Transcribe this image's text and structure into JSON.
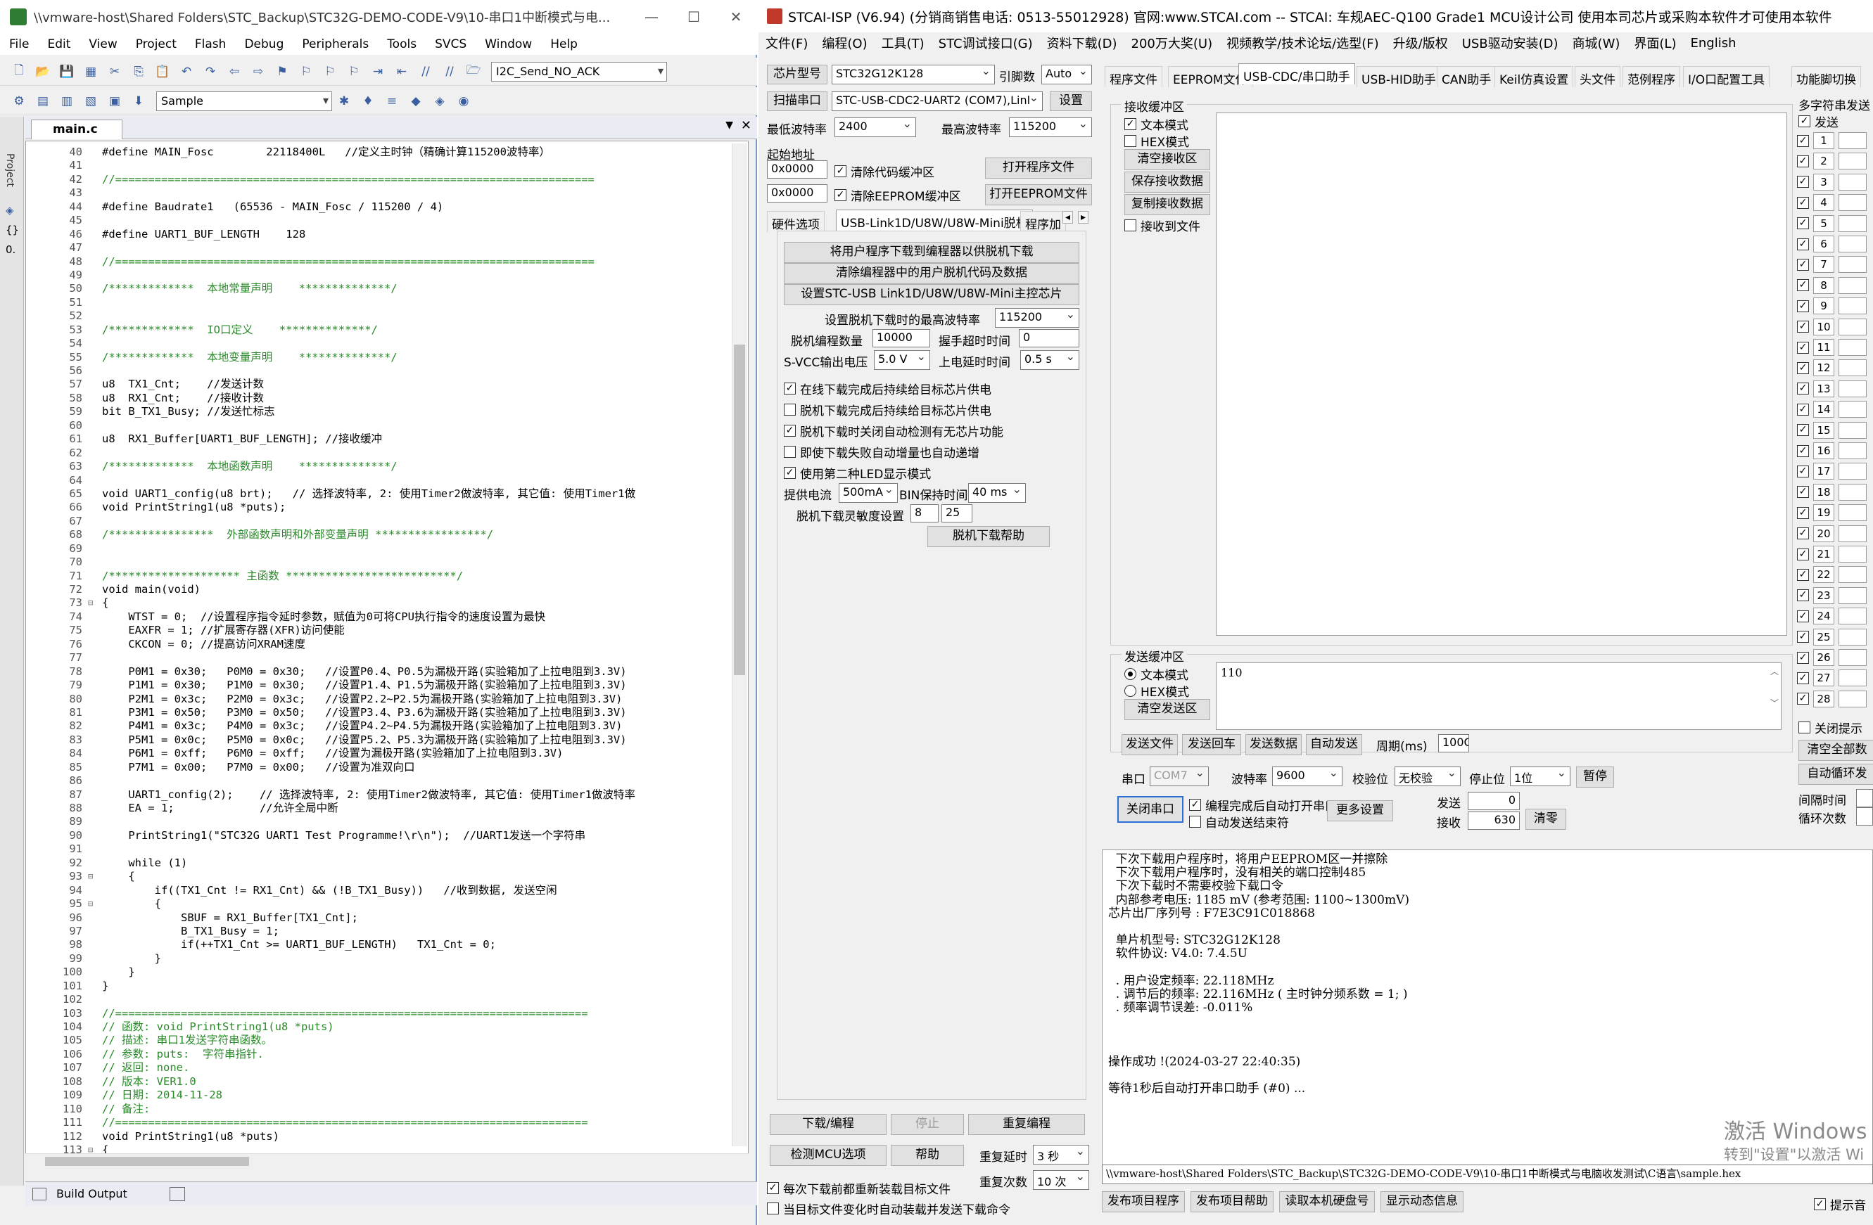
{
  "keil": {
    "title": "\\\\vmware-host\\Shared Folders\\STC_Backup\\STC32G-DEMO-CODE-V9\\10-串口1中断模式与电...",
    "menu": [
      "File",
      "Edit",
      "View",
      "Project",
      "Flash",
      "Debug",
      "Peripherals",
      "Tools",
      "SVCS",
      "Window",
      "Help"
    ],
    "toolbar_func": "I2C_Send_NO_ACK",
    "target": "Sample",
    "side_label": "Project",
    "file_tab": "main.c",
    "bottom_tab": "Build Output",
    "lines": [
      {
        "n": "40",
        "f": "",
        "c": "n",
        "t": "#define MAIN_Fosc        22118400L   //定义主时钟（精确计算115200波特率）"
      },
      {
        "n": "41",
        "f": "",
        "c": "n",
        "t": ""
      },
      {
        "n": "42",
        "f": "",
        "c": "cm",
        "t": "//========================================================================="
      },
      {
        "n": "43",
        "f": "",
        "c": "n",
        "t": ""
      },
      {
        "n": "44",
        "f": "",
        "c": "n",
        "t": "#define Baudrate1   (65536 - MAIN_Fosc / 115200 / 4)"
      },
      {
        "n": "45",
        "f": "",
        "c": "n",
        "t": ""
      },
      {
        "n": "46",
        "f": "",
        "c": "n",
        "t": "#define UART1_BUF_LENGTH    128"
      },
      {
        "n": "47",
        "f": "",
        "c": "n",
        "t": ""
      },
      {
        "n": "48",
        "f": "",
        "c": "cm",
        "t": "//========================================================================="
      },
      {
        "n": "49",
        "f": "",
        "c": "n",
        "t": ""
      },
      {
        "n": "50",
        "f": "",
        "c": "cm",
        "t": "/*************  本地常量声明    **************/"
      },
      {
        "n": "51",
        "f": "",
        "c": "n",
        "t": ""
      },
      {
        "n": "52",
        "f": "",
        "c": "n",
        "t": ""
      },
      {
        "n": "53",
        "f": "",
        "c": "cm",
        "t": "/*************  IO口定义    **************/"
      },
      {
        "n": "54",
        "f": "",
        "c": "n",
        "t": ""
      },
      {
        "n": "55",
        "f": "",
        "c": "cm",
        "t": "/*************  本地变量声明    **************/"
      },
      {
        "n": "56",
        "f": "",
        "c": "n",
        "t": ""
      },
      {
        "n": "57",
        "f": "",
        "c": "n",
        "t": "u8  TX1_Cnt;    //发送计数"
      },
      {
        "n": "58",
        "f": "",
        "c": "n",
        "t": "u8  RX1_Cnt;    //接收计数"
      },
      {
        "n": "59",
        "f": "",
        "c": "n",
        "t": "bit B_TX1_Busy; //发送忙标志"
      },
      {
        "n": "60",
        "f": "",
        "c": "n",
        "t": ""
      },
      {
        "n": "61",
        "f": "",
        "c": "n",
        "t": "u8  RX1_Buffer[UART1_BUF_LENGTH]; //接收缓冲"
      },
      {
        "n": "62",
        "f": "",
        "c": "n",
        "t": ""
      },
      {
        "n": "63",
        "f": "",
        "c": "cm",
        "t": "/*************  本地函数声明    **************/"
      },
      {
        "n": "64",
        "f": "",
        "c": "n",
        "t": ""
      },
      {
        "n": "65",
        "f": "",
        "c": "n",
        "t": "void UART1_config(u8 brt);   // 选择波特率, 2: 使用Timer2做波特率, 其它值: 使用Timer1做"
      },
      {
        "n": "66",
        "f": "",
        "c": "n",
        "t": "void PrintString1(u8 *puts);"
      },
      {
        "n": "67",
        "f": "",
        "c": "n",
        "t": ""
      },
      {
        "n": "68",
        "f": "",
        "c": "cm",
        "t": "/****************  外部函数声明和外部变量声明 *****************/"
      },
      {
        "n": "69",
        "f": "",
        "c": "n",
        "t": ""
      },
      {
        "n": "70",
        "f": "",
        "c": "n",
        "t": ""
      },
      {
        "n": "71",
        "f": "",
        "c": "cm",
        "t": "/******************** 主函数 **************************/"
      },
      {
        "n": "72",
        "f": "",
        "c": "n",
        "t": "void main(void)"
      },
      {
        "n": "73",
        "f": "⊟",
        "c": "n",
        "t": "{"
      },
      {
        "n": "74",
        "f": "",
        "c": "n",
        "t": "    WTST = 0;  //设置程序指令延时参数，赋值为0可将CPU执行指令的速度设置为最快"
      },
      {
        "n": "75",
        "f": "",
        "c": "n",
        "t": "    EAXFR = 1; //扩展寄存器(XFR)访问使能"
      },
      {
        "n": "76",
        "f": "",
        "c": "n",
        "t": "    CKCON = 0; //提高访问XRAM速度"
      },
      {
        "n": "77",
        "f": "",
        "c": "n",
        "t": ""
      },
      {
        "n": "78",
        "f": "",
        "c": "n",
        "t": "    P0M1 = 0x30;   P0M0 = 0x30;   //设置P0.4、P0.5为漏极开路(实验箱加了上拉电阻到3.3V)"
      },
      {
        "n": "79",
        "f": "",
        "c": "n",
        "t": "    P1M1 = 0x30;   P1M0 = 0x30;   //设置P1.4、P1.5为漏极开路(实验箱加了上拉电阻到3.3V)"
      },
      {
        "n": "80",
        "f": "",
        "c": "n",
        "t": "    P2M1 = 0x3c;   P2M0 = 0x3c;   //设置P2.2~P2.5为漏极开路(实验箱加了上拉电阻到3.3V)"
      },
      {
        "n": "81",
        "f": "",
        "c": "n",
        "t": "    P3M1 = 0x50;   P3M0 = 0x50;   //设置P3.4、P3.6为漏极开路(实验箱加了上拉电阻到3.3V)"
      },
      {
        "n": "82",
        "f": "",
        "c": "n",
        "t": "    P4M1 = 0x3c;   P4M0 = 0x3c;   //设置P4.2~P4.5为漏极开路(实验箱加了上拉电阻到3.3V)"
      },
      {
        "n": "83",
        "f": "",
        "c": "n",
        "t": "    P5M1 = 0x0c;   P5M0 = 0x0c;   //设置P5.2、P5.3为漏极开路(实验箱加了上拉电阻到3.3V)"
      },
      {
        "n": "84",
        "f": "",
        "c": "n",
        "t": "    P6M1 = 0xff;   P6M0 = 0xff;   //设置为漏极开路(实验箱加了上拉电阻到3.3V)"
      },
      {
        "n": "85",
        "f": "",
        "c": "n",
        "t": "    P7M1 = 0x00;   P7M0 = 0x00;   //设置为准双向口"
      },
      {
        "n": "86",
        "f": "",
        "c": "n",
        "t": ""
      },
      {
        "n": "87",
        "f": "",
        "c": "n",
        "t": "    UART1_config(2);    // 选择波特率, 2: 使用Timer2做波特率, 其它值: 使用Timer1做波特率"
      },
      {
        "n": "88",
        "f": "",
        "c": "n",
        "t": "    EA = 1;             //允许全局中断"
      },
      {
        "n": "89",
        "f": "",
        "c": "n",
        "t": ""
      },
      {
        "n": "90",
        "f": "",
        "c": "n",
        "t": "    PrintString1(\"STC32G UART1 Test Programme!\\r\\n\");  //UART1发送一个字符串"
      },
      {
        "n": "91",
        "f": "",
        "c": "n",
        "t": ""
      },
      {
        "n": "92",
        "f": "",
        "c": "n",
        "t": "    while (1)"
      },
      {
        "n": "93",
        "f": "⊟",
        "c": "n",
        "t": "    {"
      },
      {
        "n": "94",
        "f": "",
        "c": "n",
        "t": "        if((TX1_Cnt != RX1_Cnt) && (!B_TX1_Busy))   //收到数据, 发送空闲"
      },
      {
        "n": "95",
        "f": "⊟",
        "c": "n",
        "t": "        {"
      },
      {
        "n": "96",
        "f": "",
        "c": "n",
        "t": "            SBUF = RX1_Buffer[TX1_Cnt];"
      },
      {
        "n": "97",
        "f": "",
        "c": "n",
        "t": "            B_TX1_Busy = 1;"
      },
      {
        "n": "98",
        "f": "",
        "c": "n",
        "t": "            if(++TX1_Cnt >= UART1_BUF_LENGTH)   TX1_Cnt = 0;"
      },
      {
        "n": "99",
        "f": "",
        "c": "n",
        "t": "        }"
      },
      {
        "n": "100",
        "f": "",
        "c": "n",
        "t": "    }"
      },
      {
        "n": "101",
        "f": "",
        "c": "n",
        "t": "}"
      },
      {
        "n": "102",
        "f": "",
        "c": "n",
        "t": ""
      },
      {
        "n": "103",
        "f": "",
        "c": "cm",
        "t": "//========================================================================"
      },
      {
        "n": "104",
        "f": "",
        "c": "cm",
        "t": "// 函数: void PrintString1(u8 *puts)"
      },
      {
        "n": "105",
        "f": "",
        "c": "cm",
        "t": "// 描述: 串口1发送字符串函数。"
      },
      {
        "n": "106",
        "f": "",
        "c": "cm",
        "t": "// 参数: puts:  字符串指针."
      },
      {
        "n": "107",
        "f": "",
        "c": "cm",
        "t": "// 返回: none."
      },
      {
        "n": "108",
        "f": "",
        "c": "cm",
        "t": "// 版本: VER1.0"
      },
      {
        "n": "109",
        "f": "",
        "c": "cm",
        "t": "// 日期: 2014-11-28"
      },
      {
        "n": "110",
        "f": "",
        "c": "cm",
        "t": "// 备注:"
      },
      {
        "n": "111",
        "f": "",
        "c": "cm",
        "t": "//========================================================================"
      },
      {
        "n": "112",
        "f": "",
        "c": "n",
        "t": "void PrintString1(u8 *puts)"
      },
      {
        "n": "113",
        "f": "⊟",
        "c": "n",
        "t": "{"
      }
    ]
  },
  "stc": {
    "title": "STCAI-ISP (V6.94) (分销商销售电话: 0513-55012928) 官网:www.STCAI.com  -- STCAI: 车规AEC-Q100 Grade1 MCU设计公司 使用本司芯片或采购本软件才可使用本软件",
    "menu": [
      "文件(F)",
      "编程(O)",
      "工具(T)",
      "STC调试接口(G)",
      "资料下载(D)",
      "200万大奖(U)",
      "视频教学/技术论坛/选型(F)",
      "升级/版权",
      "USB驱动安装(D)",
      "商城(W)",
      "界面(L)",
      "English"
    ],
    "chip_label": "芯片型号",
    "chip": "STC32G12K128",
    "pins_label": "引脚数",
    "pins": "Auto",
    "scan_btn": "扫描串口",
    "port": "STC-USB-CDC2-UART2 (COM7),Linl",
    "settings_btn": "设置",
    "min_baud_label": "最低波特率",
    "min_baud": "2400",
    "max_baud_label": "最高波特率",
    "max_baud": "115200",
    "start_addr_label": "起始地址",
    "addr1": "0x0000",
    "addr2": "0x0000",
    "clear_code_buf": "清除代码缓冲区",
    "clear_eeprom_buf": "清除EEPROM缓冲区",
    "open_prog_btn": "打开程序文件",
    "open_eeprom_btn": "打开EEPROM文件",
    "left_tabs": [
      "硬件选项",
      "USB-Link1D/U8W/U8W-Mini脱机",
      "程序加"
    ],
    "offline_btns": [
      "将用户程序下载到编程器以供脱机下载",
      "清除编程器中的用户脱机代码及数据",
      "设置STC-USB Link1D/U8W/U8W-Mini主控芯片"
    ],
    "offline_max_baud_label": "设置脱机下载时的最高波特率",
    "offline_max_baud": "115200",
    "offline_count_label": "脱机编程数量",
    "offline_count": "10000",
    "handshake_label": "握手超时时间",
    "handshake": "0",
    "svcc_label": "S-VCC输出电压",
    "svcc": "5.0 V",
    "power_delay_label": "上电延时时间",
    "power_delay": "0.5 s",
    "offline_opts": [
      {
        "label": "在线下载完成后持续给目标芯片供电",
        "checked": "✓"
      },
      {
        "label": "脱机下载完成后持续给目标芯片供电",
        "checked": ""
      },
      {
        "label": "脱机下载时关闭自动检测有无芯片功能",
        "checked": "✓"
      },
      {
        "label": "即使下载失败自动增量也自动递增",
        "checked": ""
      },
      {
        "label": "使用第二种LED显示模式",
        "checked": "✓"
      }
    ],
    "supply_current_label": "提供电流",
    "supply_current": "500mA",
    "bin_hold_label": "BIN保持时间",
    "bin_hold": "40 ms",
    "sensitivity_label": "脱机下载灵敏度设置",
    "sens1": "8",
    "sens2": "25",
    "offline_help_btn": "脱机下载帮助",
    "download_btn": "下载/编程",
    "stop_btn": "停止",
    "reprogram_btn": "重复编程",
    "check_mcu_btn": "检测MCU选项",
    "help_btn": "帮助",
    "repeat_delay_label": "重复延时",
    "repeat_delay": "3 秒",
    "repeat_count_label": "重复次数",
    "repeat_count": "10 次",
    "reload_before": "每次下载前都重新装载目标文件",
    "auto_reload": "当目标文件变化时自动装载并发送下载命令",
    "right_tabs": [
      "程序文件",
      "EEPROM文件",
      "USB-CDC/串口助手",
      "USB-HID助手",
      "CAN助手",
      "Keil仿真设置",
      "头文件",
      "范例程序",
      "I/O口配置工具",
      "功能脚切换"
    ],
    "recv_group": "接收缓冲区",
    "recv_text_mode": "文本模式",
    "recv_hex_mode": "HEX模式",
    "clear_recv_btn": "清空接收区",
    "save_recv_btn": "保存接收数据",
    "copy_recv_btn": "复制接收数据",
    "recv_to_file": "接收到文件",
    "send_group": "发送缓冲区",
    "send_text_mode": "文本模式",
    "send_hex_mode": "HEX模式",
    "clear_send_btn": "清空发送区",
    "send_content": "110",
    "send_file_btn": "发送文件",
    "send_return_btn": "发送回车",
    "send_data_btn": "发送数据",
    "auto_send_btn": "自动发送",
    "period_label": "周期(ms)",
    "period": "100C",
    "serial_label": "串口",
    "serial": "COM7",
    "baud_label": "波特率",
    "baud": "9600",
    "parity_label": "校验位",
    "parity": "无校验",
    "stop_label": "停止位",
    "stop": "1位",
    "pause_btn": "暂停",
    "close_port_btn": "关闭串口",
    "auto_open_after": "编程完成后自动打开串口",
    "auto_send_end": "自动发送结束符",
    "more_settings_btn": "更多设置",
    "send_count_label": "发送",
    "send_count": "0",
    "recv_count_label": "接收",
    "recv_count": "630",
    "clear_count_btn": "清零",
    "multi_label": "多字符串发送",
    "multi_send": "发送",
    "multi_rows": [
      "1",
      "2",
      "3",
      "4",
      "5",
      "6",
      "7",
      "8",
      "9",
      "10",
      "11",
      "12",
      "13",
      "14",
      "15",
      "16",
      "17",
      "18",
      "19",
      "20",
      "21",
      "22",
      "23",
      "24",
      "25",
      "26",
      "27",
      "28"
    ],
    "close_tip": "关闭提示",
    "clear_all_btn": "清空全部数",
    "auto_loop_btn": "自动循环发",
    "interval_label": "间隔时间",
    "loop_label": "循环次数",
    "log": [
      "  下次下载用户程序时，将用户EEPROM区一并擦除",
      "  下次下载用户程序时，没有相关的端口控制485",
      "  下次下载时不需要校验下载口令",
      "  内部参考电压: 1185 mV (参考范围: 1100~1300mV)",
      "芯片出厂序列号 : F7E3C91C018868",
      "",
      "  单片机型号: STC32G12K128",
      "  软件协议: V4.0: 7.4.5U",
      "",
      "  . 用户设定频率: 22.118MHz",
      "  . 调节后的频率: 22.116MHz ( 主时钟分频系数 = 1; )",
      "  . 频率调节误差: -0.011%",
      "",
      "",
      "",
      "操作成功 !(2024-03-27 22:40:35)",
      "",
      "等待1秒后自动打开串口助手 (#0) ..."
    ],
    "watermark1": "激活 Windows",
    "watermark2": "转到\"设置\"以激活 Wi",
    "file_path": "\\\\vmware-host\\Shared Folders\\STC_Backup\\STC32G-DEMO-CODE-V9\\10-串口1中断模式与电脑收发测试\\C语言\\sample.hex",
    "bottom_btns": [
      "发布项目程序",
      "发布项目帮助",
      "读取本机硬盘号",
      "显示动态信息"
    ],
    "sound_tip": "提示音"
  }
}
